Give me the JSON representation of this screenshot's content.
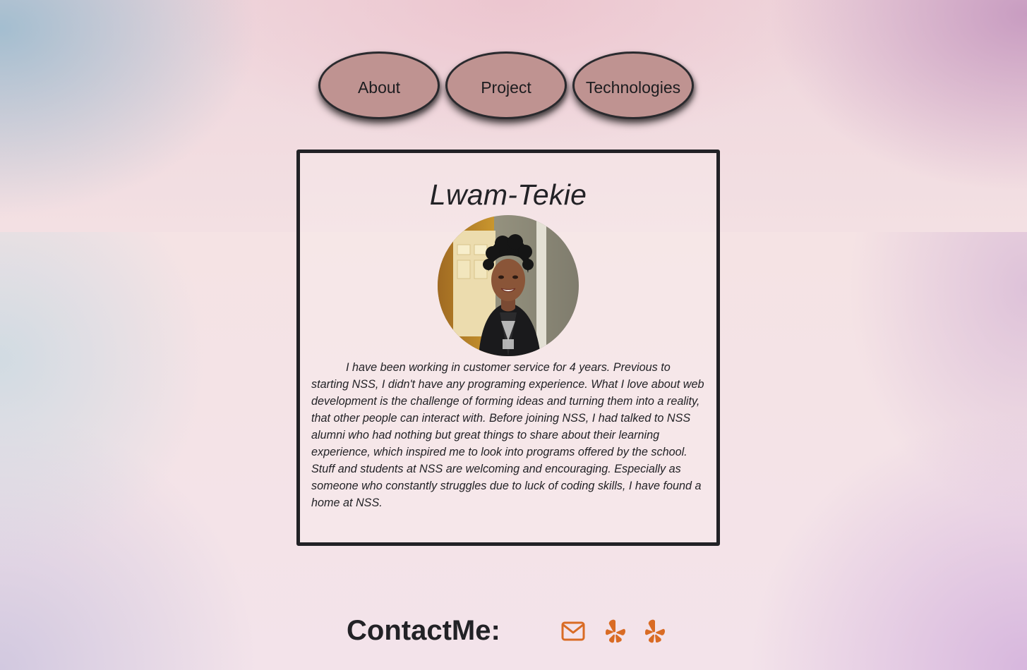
{
  "nav": {
    "items": [
      {
        "label": "About"
      },
      {
        "label": "Project"
      },
      {
        "label": "Technologies"
      }
    ]
  },
  "profile": {
    "name": "Lwam-Tekie",
    "bio": "I have been working in customer service for 4 years. Previous to starting NSS, I didn't have any programing experience. What I love about web development is the challenge of forming ideas and turning them into a reality, that other people can interact with. Before joining NSS, I had talked to NSS alumni who had nothing but great things to share about their learning experience, which inspired me to look into programs offered by the school. Stuff and students at NSS are welcoming and encouraging. Especially as someone who constantly struggles due to luck of coding skills, I have found a home at NSS."
  },
  "contact": {
    "label": "ContactMe:",
    "icons": [
      "envelope-icon",
      "yelp-icon",
      "yelp-icon"
    ]
  },
  "colors": {
    "nav_button_fill": "#bf9391",
    "icon_accent": "#d96b24",
    "border": "#222226"
  }
}
